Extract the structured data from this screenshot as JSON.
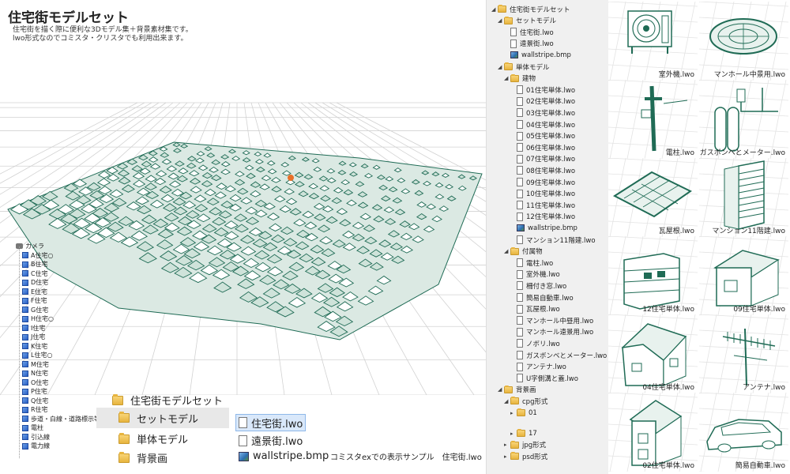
{
  "header": {
    "title": "住宅街モデルセット",
    "subtitle_line1": "住宅街を描く際に便利な3Dモデル集＋背景素材集です。",
    "subtitle_line2": "lwo形式なのでコミスタ・クリスタでも利用出来ます。"
  },
  "object_list": [
    "カメラ",
    "A住宅○",
    "B住宅",
    "C住宅",
    "D住宅",
    "E住宅",
    "F住宅",
    "G住宅",
    "H住宅○",
    "I住宅",
    "J住宅",
    "K住宅",
    "L住宅○",
    "M住宅",
    "N住宅",
    "O住宅",
    "P住宅",
    "Q住宅",
    "R住宅",
    "歩道・白線・道路標示等",
    "電柱",
    "引込線",
    "電力線"
  ],
  "file_panel": {
    "root": "住宅街モデルセット",
    "folders": [
      "セットモデル",
      "単体モデル",
      "背景画"
    ],
    "files": [
      "住宅街.lwo",
      "遠景街.lwo",
      "wallstripe.bmp"
    ],
    "caption": "コミスタexでの表示サンプル　住宅街.lwo"
  },
  "tree": [
    {
      "label": "住宅街モデルセット",
      "type": "folder",
      "level": 0,
      "expanded": true
    },
    {
      "label": "セットモデル",
      "type": "folder",
      "level": 1,
      "expanded": true
    },
    {
      "label": "住宅街.lwo",
      "type": "file",
      "level": 2
    },
    {
      "label": "遠景街.lwo",
      "type": "file",
      "level": 2
    },
    {
      "label": "wallstripe.bmp",
      "type": "bmp",
      "level": 2
    },
    {
      "label": "単体モデル",
      "type": "folder",
      "level": 1,
      "expanded": true
    },
    {
      "label": "建物",
      "type": "folder",
      "level": 2,
      "expanded": true
    },
    {
      "label": "01住宅単体.lwo",
      "type": "file",
      "level": 3
    },
    {
      "label": "02住宅単体.lwo",
      "type": "file",
      "level": 3
    },
    {
      "label": "03住宅単体.lwo",
      "type": "file",
      "level": 3
    },
    {
      "label": "04住宅単体.lwo",
      "type": "file",
      "level": 3
    },
    {
      "label": "05住宅単体.lwo",
      "type": "file",
      "level": 3
    },
    {
      "label": "06住宅単体.lwo",
      "type": "file",
      "level": 3
    },
    {
      "label": "07住宅単体.lwo",
      "type": "file",
      "level": 3
    },
    {
      "label": "08住宅単体.lwo",
      "type": "file",
      "level": 3
    },
    {
      "label": "09住宅単体.lwo",
      "type": "file",
      "level": 3
    },
    {
      "label": "10住宅単体.lwo",
      "type": "file",
      "level": 3
    },
    {
      "label": "11住宅単体.lwo",
      "type": "file",
      "level": 3
    },
    {
      "label": "12住宅単体.lwo",
      "type": "file",
      "level": 3
    },
    {
      "label": "wallstripe.bmp",
      "type": "bmp",
      "level": 3
    },
    {
      "label": "マンション11階建.lwo",
      "type": "file",
      "level": 3
    },
    {
      "label": "付属物",
      "type": "folder",
      "level": 2,
      "expanded": true
    },
    {
      "label": "電柱.lwo",
      "type": "file",
      "level": 3
    },
    {
      "label": "室外機.lwo",
      "type": "file",
      "level": 3
    },
    {
      "label": "柵付き窓.lwo",
      "type": "file",
      "level": 3
    },
    {
      "label": "簡易自動車.lwo",
      "type": "file",
      "level": 3
    },
    {
      "label": "瓦屋根.lwo",
      "type": "file",
      "level": 3
    },
    {
      "label": "マンホール中昼用.lwo",
      "type": "file",
      "level": 3
    },
    {
      "label": "マンホール遠景用.lwo",
      "type": "file",
      "level": 3
    },
    {
      "label": "ノボリ.lwo",
      "type": "file",
      "level": 3
    },
    {
      "label": "ガスボンベとメーター.lwo",
      "type": "file",
      "level": 3
    },
    {
      "label": "アンテナ.lwo",
      "type": "file",
      "level": 3
    },
    {
      "label": "U字側溝と蓋.lwo",
      "type": "file",
      "level": 3
    },
    {
      "label": "背景画",
      "type": "folder",
      "level": 1,
      "expanded": true
    },
    {
      "label": "cpg形式",
      "type": "folder",
      "level": 2,
      "expanded": true
    },
    {
      "label": "01",
      "type": "folder",
      "level": 3
    },
    {
      "label": "17",
      "type": "folder",
      "level": 3
    },
    {
      "label": "jpg形式",
      "type": "folder",
      "level": 2
    },
    {
      "label": "psd形式",
      "type": "folder",
      "level": 2
    }
  ],
  "thumbnails": [
    {
      "caption": "室外機.lwo",
      "icon": "outdoor-unit"
    },
    {
      "caption": "マンホール中景用.lwo",
      "icon": "manhole"
    },
    {
      "caption": "電柱.lwo",
      "icon": "utility-pole"
    },
    {
      "caption": "ガスボンベとメーター.lwo",
      "icon": "gas-cylinder"
    },
    {
      "caption": "瓦屋根.lwo",
      "icon": "tile-roof"
    },
    {
      "caption": "マンション11階建.lwo",
      "icon": "apartment-tower"
    },
    {
      "caption": "12住宅単体.lwo",
      "icon": "apartment-block"
    },
    {
      "caption": "09住宅単体.lwo",
      "icon": "small-house"
    },
    {
      "caption": "04住宅単体.lwo",
      "icon": "house"
    },
    {
      "caption": "アンテナ.lwo",
      "icon": "antenna"
    },
    {
      "caption": "02住宅単体.lwo",
      "icon": "two-story-house"
    },
    {
      "caption": "簡易自動車.lwo",
      "icon": "car"
    }
  ],
  "colors": {
    "model_green": "#1f6b55",
    "model_light": "#e8f2ee",
    "grid": "#d4d4d4",
    "tree_bg": "#f0f0f0",
    "accent_orange": "#e8702a"
  }
}
